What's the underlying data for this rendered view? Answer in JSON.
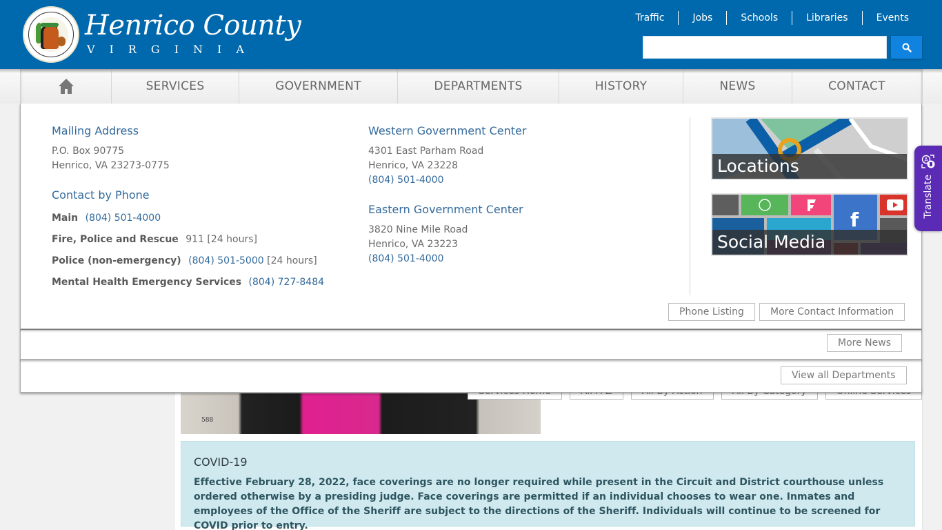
{
  "header": {
    "title": "Henrico County",
    "subtitle": "VIRGINIA",
    "utility_links": [
      "Traffic",
      "Jobs",
      "Schools",
      "Libraries",
      "Events"
    ],
    "search": {
      "value": "",
      "placeholder": ""
    }
  },
  "main_nav": {
    "home_icon": "home-icon",
    "items": [
      "SERVICES",
      "GOVERNMENT",
      "DEPARTMENTS",
      "HISTORY",
      "NEWS",
      "CONTACT"
    ]
  },
  "contact_panel": {
    "mailing": {
      "heading": "Mailing Address",
      "lines": [
        "P.O. Box 90775",
        "Henrico, VA 23273-0775"
      ]
    },
    "phone": {
      "heading": "Contact by Phone",
      "rows": [
        {
          "label": "Main",
          "number": "(804) 501-4000",
          "note": ""
        },
        {
          "label": "Fire, Police and Rescue",
          "number": "911",
          "note": "[24 hours]"
        },
        {
          "label": "Police (non-emergency)",
          "number": "(804) 501-5000",
          "note": "[24 hours]"
        },
        {
          "label": "Mental Health Emergency Services",
          "number": "(804) 727-8484",
          "note": ""
        }
      ]
    },
    "western": {
      "heading": "Western Government Center",
      "lines": [
        "4301 East Parham Road",
        "Henrico, VA 23228"
      ],
      "phone": "(804) 501-4000"
    },
    "eastern": {
      "heading": "Eastern Government Center",
      "lines": [
        "3820 Nine Mile Road",
        "Henrico, VA 23223"
      ],
      "phone": "(804) 501-4000"
    },
    "tiles": {
      "locations": "Locations",
      "social": "Social Media"
    },
    "buttons": {
      "phone_listing": "Phone Listing",
      "more_contact": "More Contact Information"
    }
  },
  "news_panel": {
    "more_news": "More News"
  },
  "dept_panel": {
    "view_all": "View all Departments"
  },
  "services_buttons": [
    "Services Home",
    "All A-Z",
    "All By Action",
    "All By Category",
    "Online Services"
  ],
  "photo": {
    "label": "588"
  },
  "alert": {
    "title": "COVID-19",
    "body": "Effective February 28, 2022, face coverings are no longer required while present in the Circuit and District courthouse unless ordered otherwise by a presiding judge. Face coverings are permitted if an individual chooses to wear one. Inmates and employees of the Office of the Sheriff are subject to the directions of the Sheriff. Individuals will continue to be screened for COVID prior to entry."
  },
  "translate": {
    "label": "Translate"
  },
  "colors": {
    "brand_blue": "#0068ac",
    "search_button": "#0f83df",
    "link": "#336a9c",
    "alert_bg": "#d0e9ef",
    "translate_bg": "#5b2bb5"
  }
}
